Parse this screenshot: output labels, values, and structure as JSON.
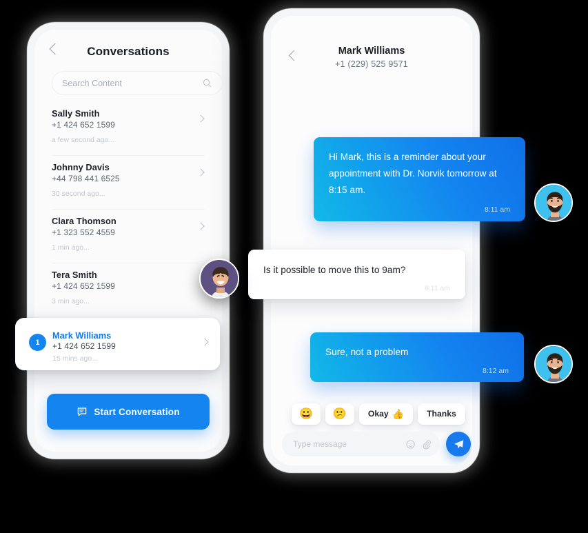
{
  "theme": {
    "background": "#000000",
    "accent": "#1484ef",
    "accent_gradient_from": "#12b9e8",
    "accent_gradient_to": "#1070e8",
    "phone_body": "#f4f5f7",
    "screen": "#fbfbfc"
  },
  "left_phone": {
    "header": {
      "title": "Conversations",
      "back_icon": "chevron-left-icon"
    },
    "search": {
      "placeholder": "Search Content",
      "value": "",
      "icon": "search-icon"
    },
    "conversations": [
      {
        "name": "Sally Smith",
        "phone": "+1 424 652 1599",
        "time": "a few second ago...",
        "unread": "",
        "active": false
      },
      {
        "name": "Johnny Davis",
        "phone": "+44 798 441 6525",
        "time": "30 second ago...",
        "unread": "",
        "active": false
      },
      {
        "name": "Clara Thomson",
        "phone": "+1 323 552 4559",
        "time": "1 min ago...",
        "unread": "",
        "active": false
      },
      {
        "name": "Tera Smith",
        "phone": "+1 424 652 1599",
        "time": "3 min ago...",
        "unread": "",
        "active": false
      }
    ],
    "highlighted_conversation": {
      "name": "Mark Williams",
      "phone": "+1 424 652 1599",
      "time": "15 mins ago...",
      "unread": "1",
      "active": true
    },
    "footer": {
      "start_button_label": "Start Conversation",
      "start_button_icon": "chat-bubble-icon"
    }
  },
  "right_phone": {
    "header": {
      "contact_name": "Mark Williams",
      "contact_phone": "+1 (229) 525 9571",
      "back_icon": "chevron-left-icon"
    },
    "messages": [
      {
        "id": "bubble-1",
        "direction": "outgoing",
        "text": "Hi Mark, this is a reminder about your appointment with Dr. Norvik tomorrow at  8:15 am.",
        "time": "8:11 am"
      },
      {
        "id": "bubble-2",
        "direction": "incoming",
        "text": "Is it possible to move this to 9am?",
        "time": "8:11 am"
      },
      {
        "id": "bubble-3",
        "direction": "outgoing",
        "text": "Sure, not a problem",
        "time": "8:12 am"
      }
    ],
    "quick_replies": [
      {
        "label": "",
        "emoji": "😀",
        "emoji_only": true
      },
      {
        "label": "",
        "emoji": "😕",
        "emoji_only": true
      },
      {
        "label": "Okay",
        "emoji": "👍",
        "emoji_only": false
      },
      {
        "label": "Thanks",
        "emoji": "",
        "emoji_only": false
      }
    ],
    "composer": {
      "placeholder": "Type message",
      "value": "",
      "emoji_icon": "smiley-icon",
      "attach_icon": "paperclip-icon",
      "send_icon": "send-paper-plane-icon"
    }
  },
  "avatars": [
    {
      "name": "avatar-bearded-man-top",
      "bg": "#3ec1ee",
      "position": "right of first outgoing message"
    },
    {
      "name": "avatar-bearded-man-bottom",
      "bg": "#3ec1ee",
      "position": "right of third outgoing message"
    },
    {
      "name": "avatar-smiling-man",
      "bg": "#5c5180",
      "position": "overlapping left phone list"
    }
  ]
}
